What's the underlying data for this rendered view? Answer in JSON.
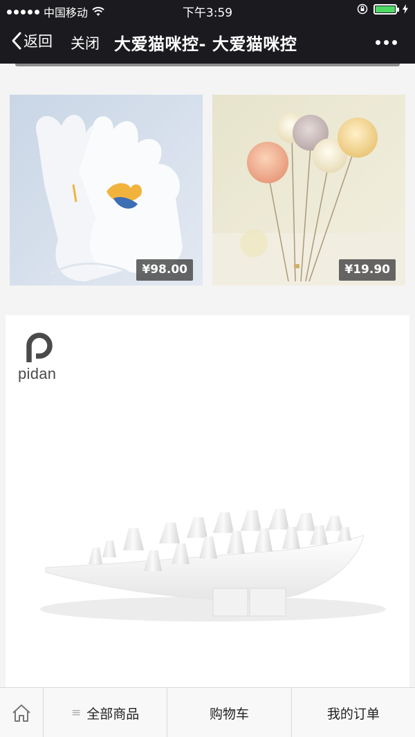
{
  "status_bar": {
    "carrier": "中国移动",
    "time": "下午3:59"
  },
  "nav": {
    "back_label": "返回",
    "close_label": "关闭",
    "title": "大爱猫咪控- 大爱猫咪控"
  },
  "products": [
    {
      "price": "¥98.00"
    },
    {
      "price": "¥19.90"
    }
  ],
  "banner": {
    "brand_name": "pidan"
  },
  "tabbar": {
    "all_products": "全部商品",
    "cart": "购物车",
    "my_orders": "我的订单"
  },
  "colors": {
    "nav_background": "#1b1b1f",
    "battery_green": "#4cd964"
  }
}
